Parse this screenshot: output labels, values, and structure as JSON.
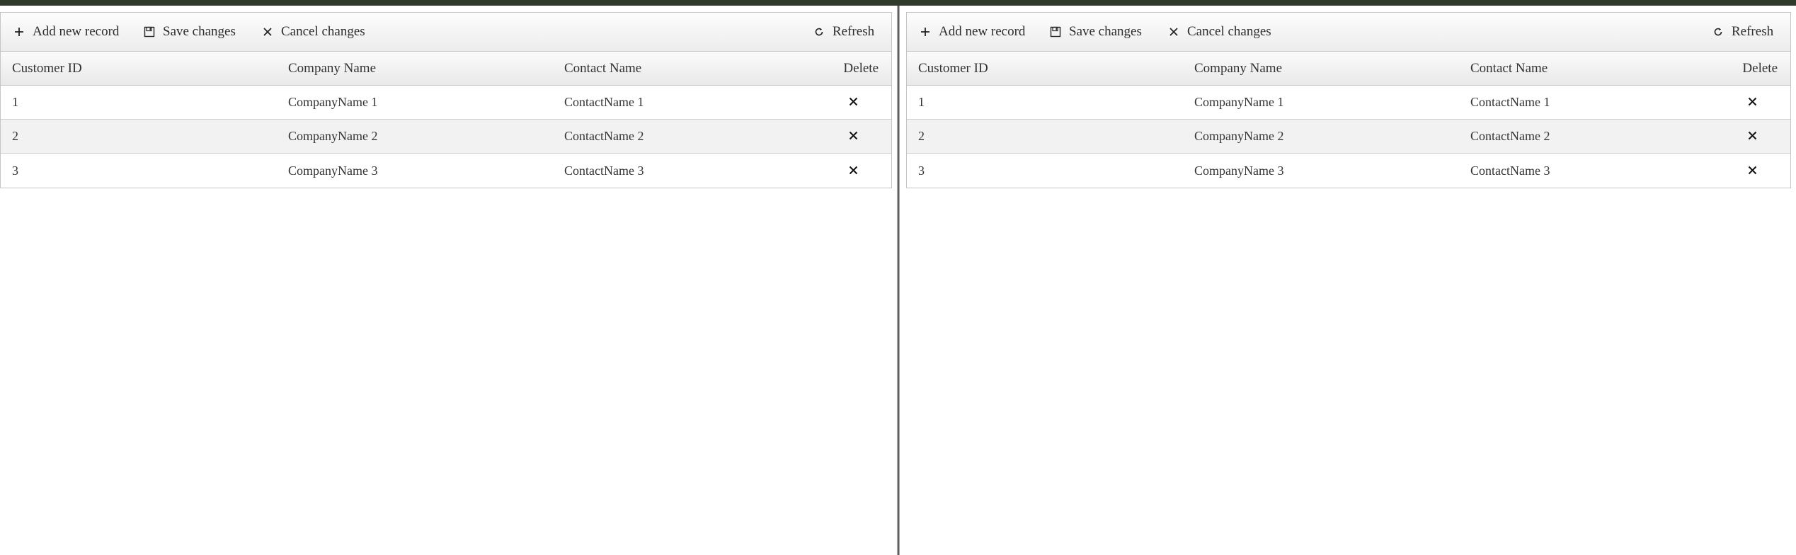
{
  "toolbar": {
    "add_label": "Add new record",
    "save_label": "Save changes",
    "cancel_label": "Cancel changes",
    "refresh_label": "Refresh",
    "icons": [
      "plus-icon",
      "floppy-disk-icon",
      "close-icon",
      "refresh-icon"
    ]
  },
  "columns": {
    "customer_id": "Customer ID",
    "company_name": "Company Name",
    "contact_name": "Contact Name",
    "delete": "Delete"
  },
  "rows": [
    {
      "customer_id": "1",
      "company_name": "CompanyName 1",
      "contact_name": "ContactName 1"
    },
    {
      "customer_id": "2",
      "company_name": "CompanyName 2",
      "contact_name": "ContactName 2"
    },
    {
      "customer_id": "3",
      "company_name": "CompanyName 3",
      "contact_name": "ContactName 3"
    }
  ],
  "colors": {
    "top_bar": "#2f3a2b",
    "grid_border": "#c5c5c5",
    "alt_row": "#f2f2f2",
    "text": "#333333"
  }
}
